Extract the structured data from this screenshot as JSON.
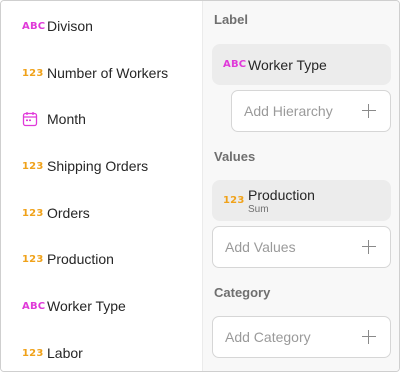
{
  "fields": [
    {
      "type": "ABC",
      "label": "Divison",
      "icon": "text-type-icon"
    },
    {
      "type": "123",
      "label": "Number of Workers",
      "icon": "number-type-icon"
    },
    {
      "type": "date",
      "label": "Month",
      "icon": "calendar-icon"
    },
    {
      "type": "123",
      "label": "Shipping Orders",
      "icon": "number-type-icon"
    },
    {
      "type": "123",
      "label": "Orders",
      "icon": "number-type-icon"
    },
    {
      "type": "123",
      "label": "Production",
      "icon": "number-type-icon"
    },
    {
      "type": "ABC",
      "label": "Worker Type",
      "icon": "text-type-icon"
    },
    {
      "type": "123",
      "label": "Labor",
      "icon": "number-type-icon"
    }
  ],
  "panel": {
    "label_title": "Label",
    "label_chip": {
      "type": "ABC",
      "name": "Worker Type"
    },
    "hierarchy_placeholder": "Add Hierarchy",
    "values_title": "Values",
    "values_chip": {
      "type": "123",
      "name": "Production",
      "aggregation": "Sum"
    },
    "values_placeholder": "Add Values",
    "category_title": "Category",
    "category_placeholder": "Add Category"
  },
  "colors": {
    "text_type": "#e03ad9",
    "number_type": "#f0a21a",
    "date_type": "#e03ad9"
  }
}
